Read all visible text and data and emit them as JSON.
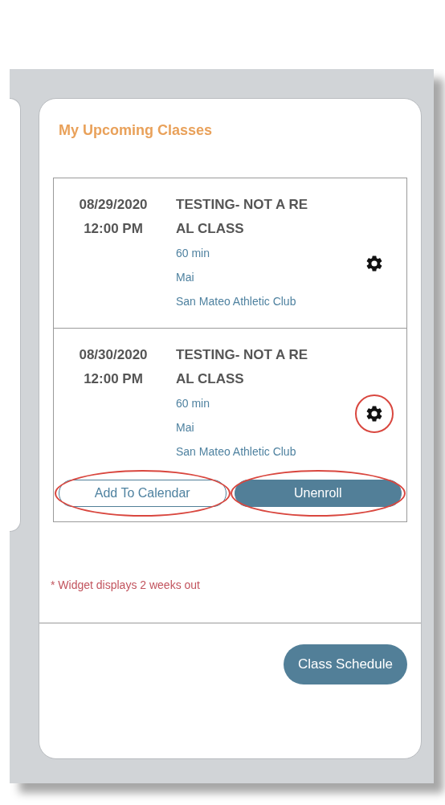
{
  "widget": {
    "title": "My Upcoming Classes",
    "classes": [
      {
        "date": "08/29/2020",
        "time": "12:00 PM",
        "title_lines": [
          "TESTING- NOT A RE",
          "AL CLASS"
        ],
        "duration": "60 min",
        "instructor": "Mai",
        "location": "San Mateo Athletic Club",
        "highlighted": false
      },
      {
        "date": "08/30/2020",
        "time": "12:00 PM",
        "title_lines": [
          "TESTING- NOT A RE",
          "AL CLASS"
        ],
        "duration": "60 min",
        "instructor": "Mai",
        "location": "San Mateo Athletic Club",
        "highlighted": true,
        "buttons": [
          {
            "kind": "outline",
            "label": "Add To Calendar"
          },
          {
            "kind": "filled",
            "label": "Unenroll"
          }
        ]
      }
    ],
    "note": "* Widget displays 2 weeks out",
    "footer_button": "Class Schedule"
  }
}
